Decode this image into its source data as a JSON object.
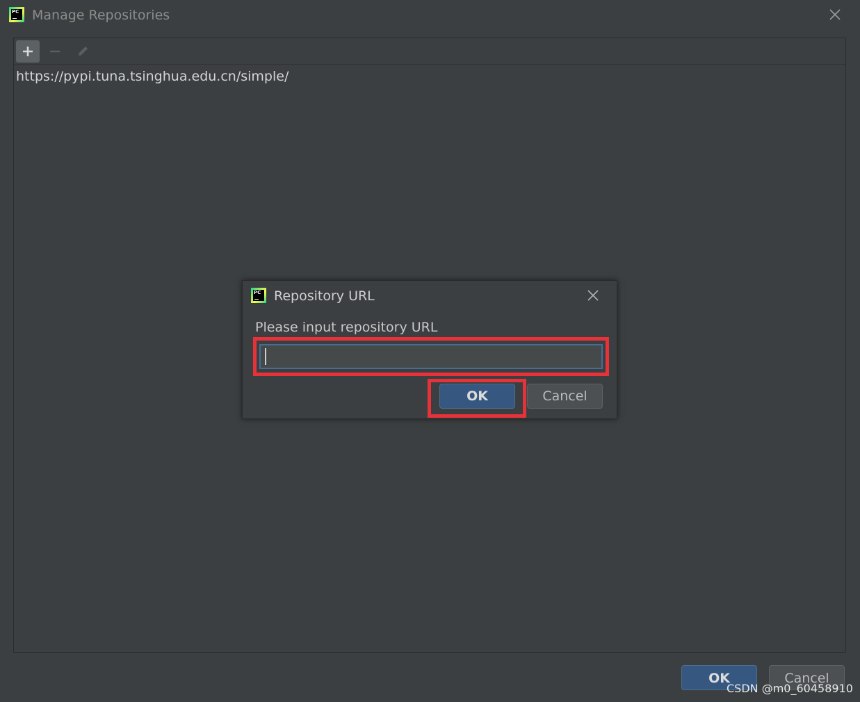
{
  "window": {
    "title": "Manage Repositories",
    "app_icon_label": "PC"
  },
  "toolbar": {
    "add_icon": "plus-icon",
    "remove_icon": "minus-icon",
    "edit_icon": "pencil-icon"
  },
  "repositories": [
    "https://pypi.tuna.tsinghua.edu.cn/simple/"
  ],
  "footer": {
    "ok_label": "OK",
    "cancel_label": "Cancel"
  },
  "dialog": {
    "title": "Repository URL",
    "app_icon_label": "PC",
    "prompt": "Please input repository URL",
    "url_value": "",
    "ok_label": "OK",
    "cancel_label": "Cancel"
  },
  "watermark": "CSDN @m0_60458910",
  "colors": {
    "background": "#3c3f41",
    "primary_button": "#365880",
    "secondary_button": "#4c5052",
    "focus_border": "#466d94",
    "highlight": "#e8323a"
  }
}
